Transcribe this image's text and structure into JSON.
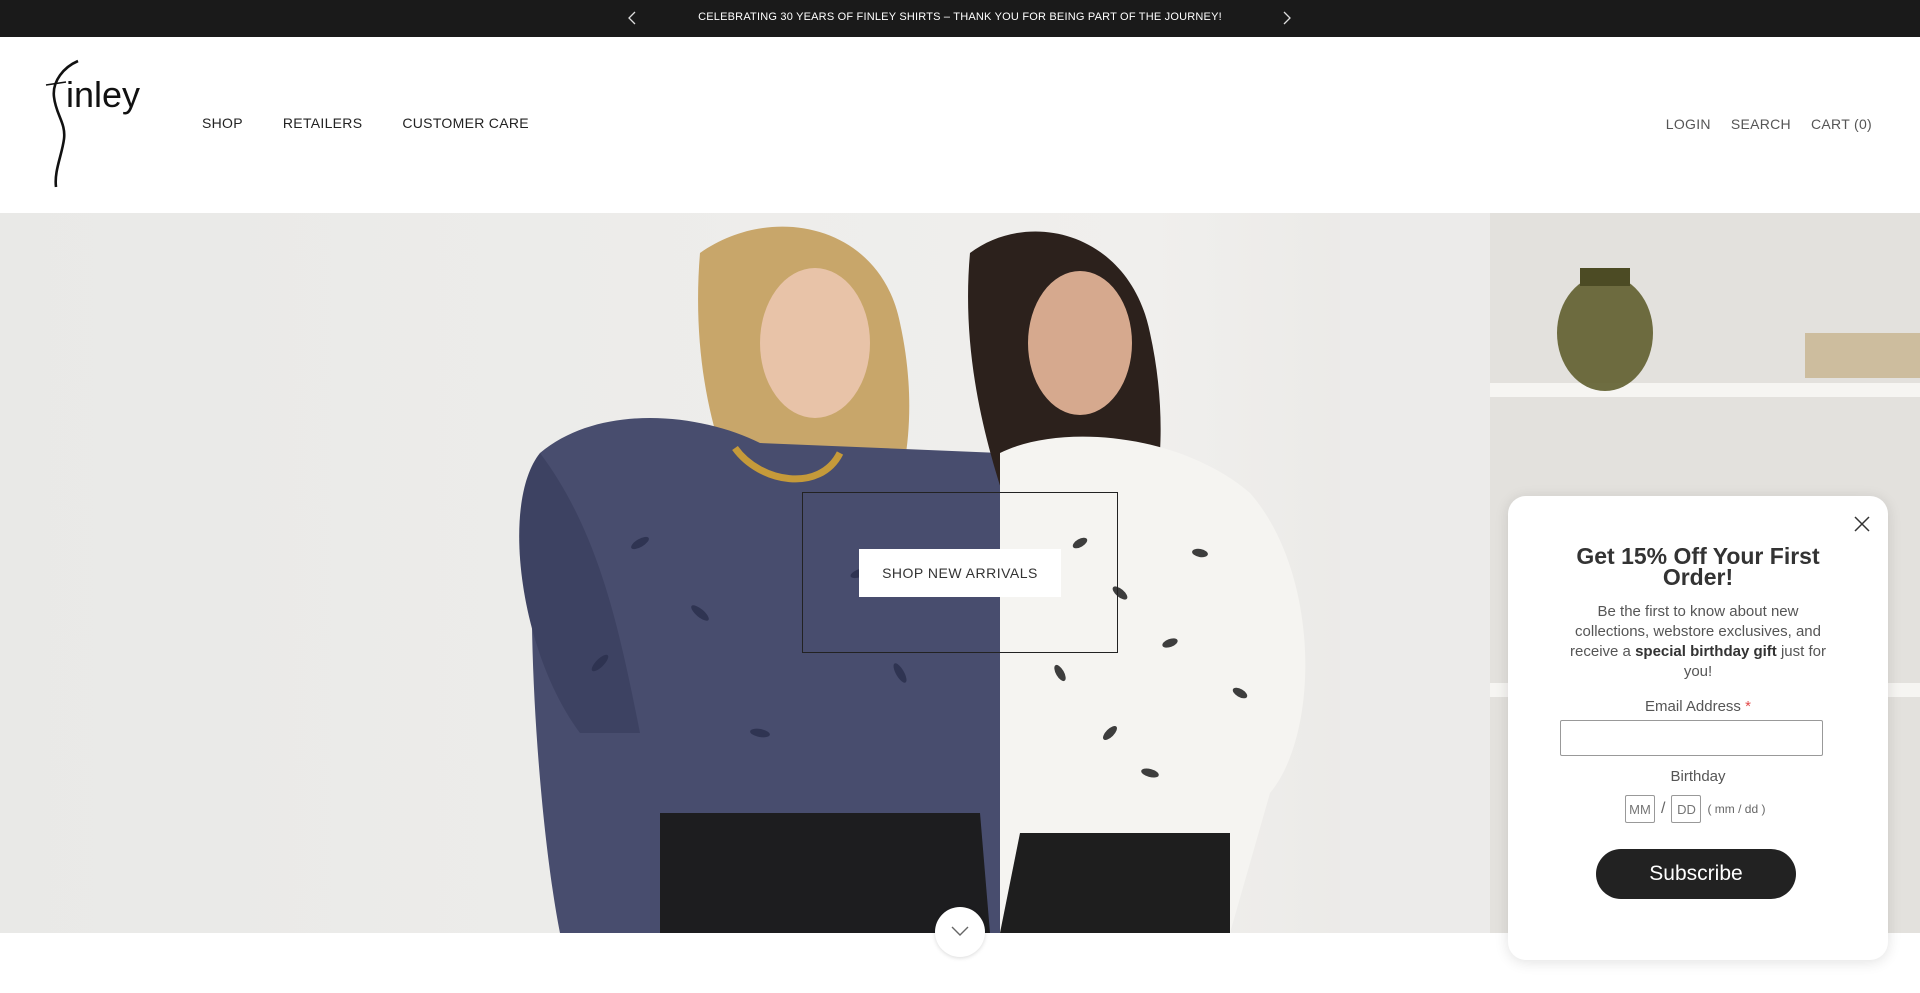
{
  "announcement": {
    "text": "CELEBRATING 30 YEARS OF FINLEY SHIRTS – THANK YOU FOR BEING PART OF THE JOURNEY!"
  },
  "header": {
    "logo_text": "finley",
    "nav": [
      "SHOP",
      "RETAILERS",
      "CUSTOMER CARE"
    ],
    "utility": {
      "login": "LOGIN",
      "search": "SEARCH",
      "cart": "CART (0)"
    }
  },
  "hero": {
    "cta": "SHOP NEW ARRIVALS"
  },
  "popup": {
    "title": "Get 15% Off Your First Order!",
    "desc_before": "Be the first to know about new collections, webstore exclusives, and receive a ",
    "desc_bold": "special birthday gift",
    "desc_after": " just for you!",
    "email_label": "Email Address",
    "required_mark": "*",
    "email_value": "",
    "birthday_label": "Birthday",
    "month_placeholder": "MM",
    "day_placeholder": "DD",
    "separator": "/",
    "date_format": "( mm / dd )",
    "subscribe": "Subscribe"
  },
  "icons": {
    "prev": "chevron-left-icon",
    "next": "chevron-right-icon",
    "close": "close-icon",
    "scroll": "chevron-down-icon"
  },
  "colors": {
    "announcement_bg": "#1a1a1a",
    "subscribe_bg": "#222222",
    "required": "#e24b4b"
  }
}
